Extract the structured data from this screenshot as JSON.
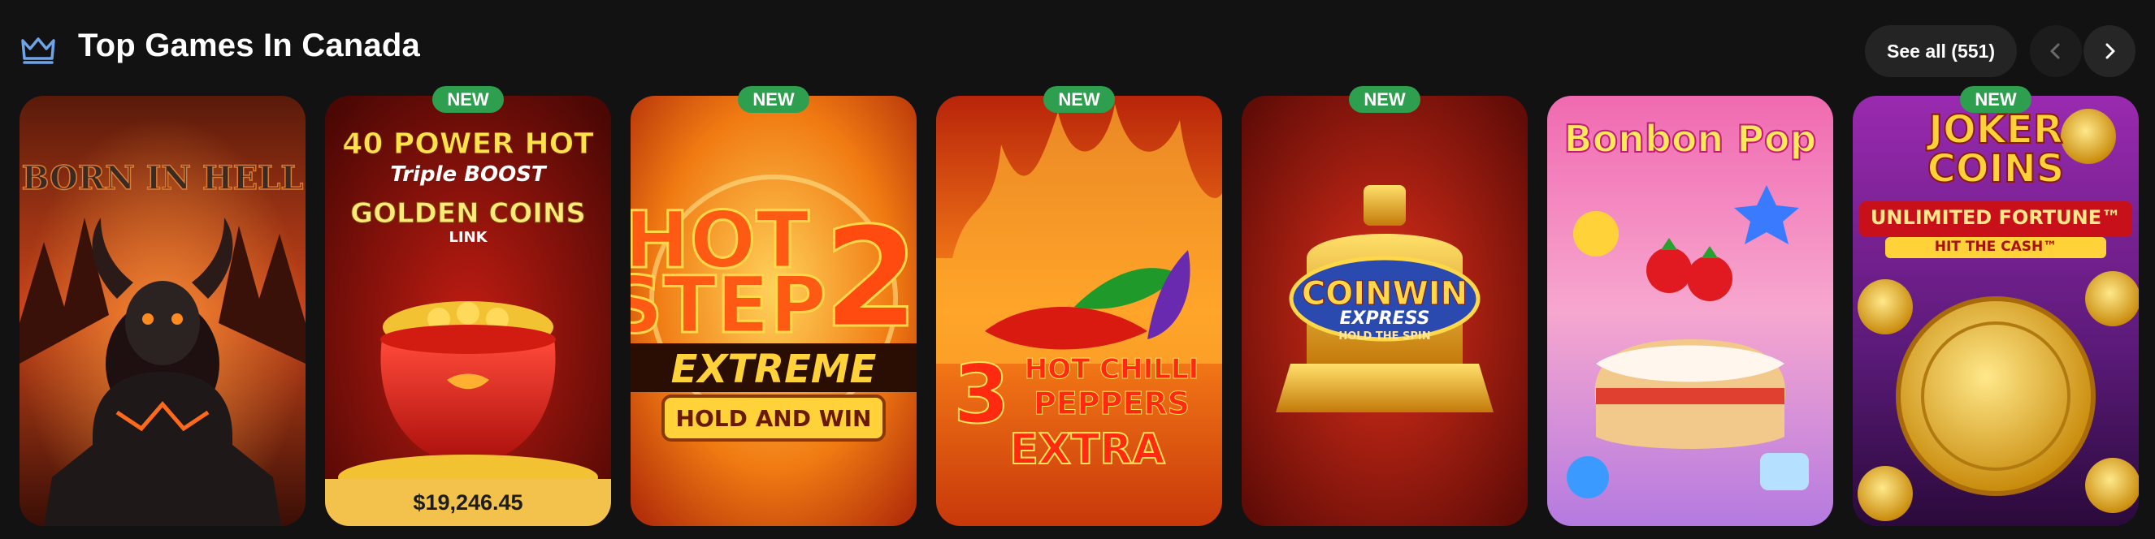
{
  "header": {
    "title": "Top Games In Canada",
    "icon": "crown-icon",
    "accent_color": "#6ea3e8",
    "see_all_label": "See all (551)"
  },
  "badge_color": "#2e9e4f",
  "games": [
    {
      "name_lines": [
        "BORN IN HELL"
      ],
      "badge": ""
    },
    {
      "name_lines": [
        "40 POWER HOT",
        "Triple BOOST",
        "GOLDEN COINS",
        "LINK"
      ],
      "badge": "NEW",
      "jackpot": "$19,246.45"
    },
    {
      "name_lines": [
        "HOT",
        "STEP",
        "2",
        "EXTREME",
        "HOLD AND WIN"
      ],
      "badge": "NEW"
    },
    {
      "name_lines": [
        "3",
        "HOT CHILLI",
        "PEPPERS",
        "EXTRA"
      ],
      "badge": "NEW"
    },
    {
      "name_lines": [
        "COINWIN",
        "EXPRESS",
        "HOLD THE SPIN"
      ],
      "badge": "NEW"
    },
    {
      "name_lines": [
        "Bonbon Pop"
      ],
      "badge": ""
    },
    {
      "name_lines": [
        "JOKER",
        "COINS",
        "UNLIMITED FORTUNE™",
        "HIT THE CASH™"
      ],
      "badge": "NEW"
    }
  ]
}
